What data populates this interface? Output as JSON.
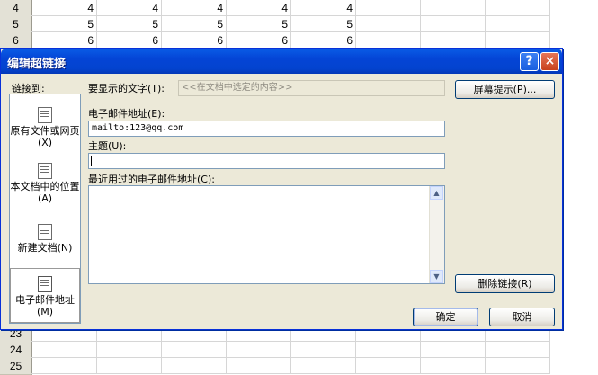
{
  "sheet": {
    "top_rows": [
      {
        "num": "4",
        "values": [
          "4",
          "4",
          "4",
          "4",
          "4"
        ]
      },
      {
        "num": "5",
        "values": [
          "5",
          "5",
          "5",
          "5",
          "5"
        ]
      },
      {
        "num": "6",
        "values": [
          "6",
          "6",
          "6",
          "6",
          "6"
        ]
      }
    ],
    "bottom_rows": [
      "23",
      "24",
      "25"
    ]
  },
  "dialog": {
    "title": "编辑超链接",
    "help_glyph": "?",
    "close_glyph": "×",
    "link_to_label": "链接到:",
    "display_text_label": "要显示的文字(T):",
    "display_text_value": "<<在文档中选定的内容>>",
    "screentip_button": "屏幕提示(P)...",
    "nav": [
      {
        "label": "原有文件或网页(X)",
        "icon": "web-page-icon"
      },
      {
        "label": "本文档中的位置(A)",
        "icon": "document-place-icon"
      },
      {
        "label": "新建文档(N)",
        "icon": "new-document-icon"
      },
      {
        "label": "电子邮件地址(M)",
        "icon": "email-icon",
        "selected": true
      }
    ],
    "email_label": "电子邮件地址(E):",
    "email_value": "mailto:123@qq.com",
    "subject_label": "主题(U):",
    "subject_value": "",
    "recent_label": "最近用过的电子邮件地址(C):",
    "remove_link_button": "删除链接(R)",
    "ok_button": "确定",
    "cancel_button": "取消"
  }
}
